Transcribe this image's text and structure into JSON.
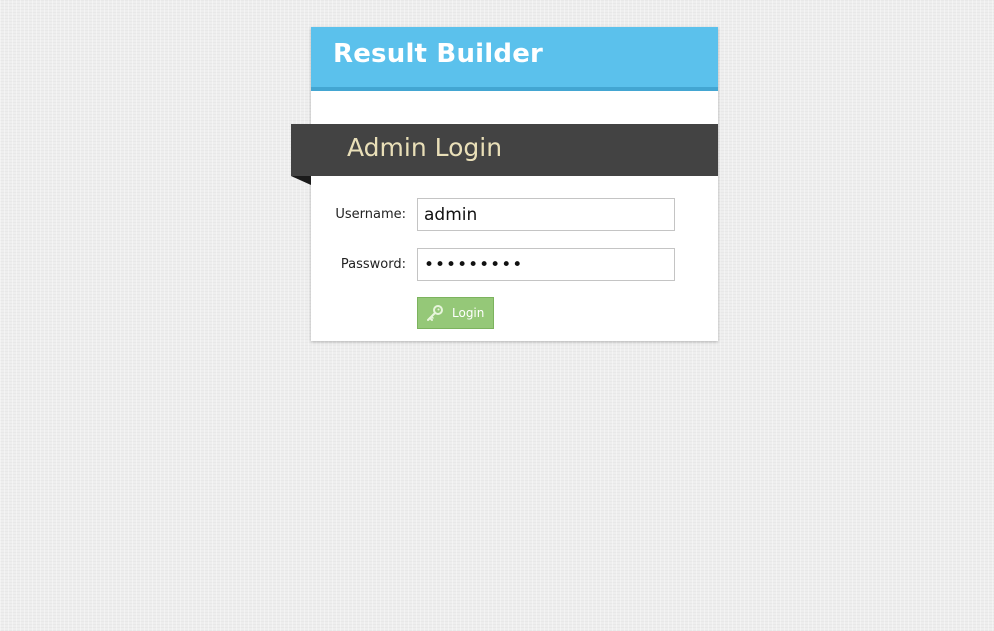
{
  "app": {
    "title": "Result Builder"
  },
  "login": {
    "heading": "Admin Login",
    "username_label": "Username:",
    "username_value": "admin",
    "password_label": "Password:",
    "password_value": "123456789",
    "button_label": "Login",
    "button_icon": "key-icon"
  },
  "colors": {
    "header": "#5bc1ec",
    "ribbon": "#434343",
    "ribbon_text": "#e9dfb8",
    "button": "#95c878"
  }
}
